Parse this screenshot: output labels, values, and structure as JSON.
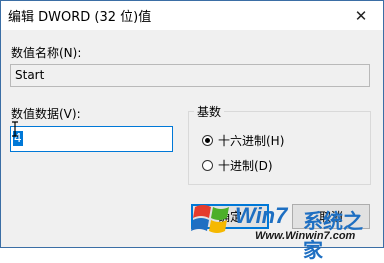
{
  "window": {
    "title": "编辑 DWORD (32 位)值",
    "close_glyph": "✕"
  },
  "value_name": {
    "label": "数值名称(N):",
    "value": "Start"
  },
  "value_data": {
    "label": "数值数据(V):",
    "value": "4"
  },
  "base": {
    "group_label": "基数",
    "options": [
      {
        "label": "十六进制(H)",
        "checked": true
      },
      {
        "label": "十进制(D)",
        "checked": false
      }
    ]
  },
  "buttons": {
    "ok_label": "确定",
    "cancel_label": "取消"
  },
  "watermark": {
    "brand": "Win7",
    "site_name": "系统之家",
    "url": "Www.Winwin7.com"
  },
  "colors": {
    "accent": "#0078d7",
    "window_bg": "#f0f0f0",
    "logo_blue": "#1e6fc2",
    "logo_red": "#e53b2c",
    "logo_green": "#4caf2a",
    "logo_yellow": "#f5b800"
  }
}
